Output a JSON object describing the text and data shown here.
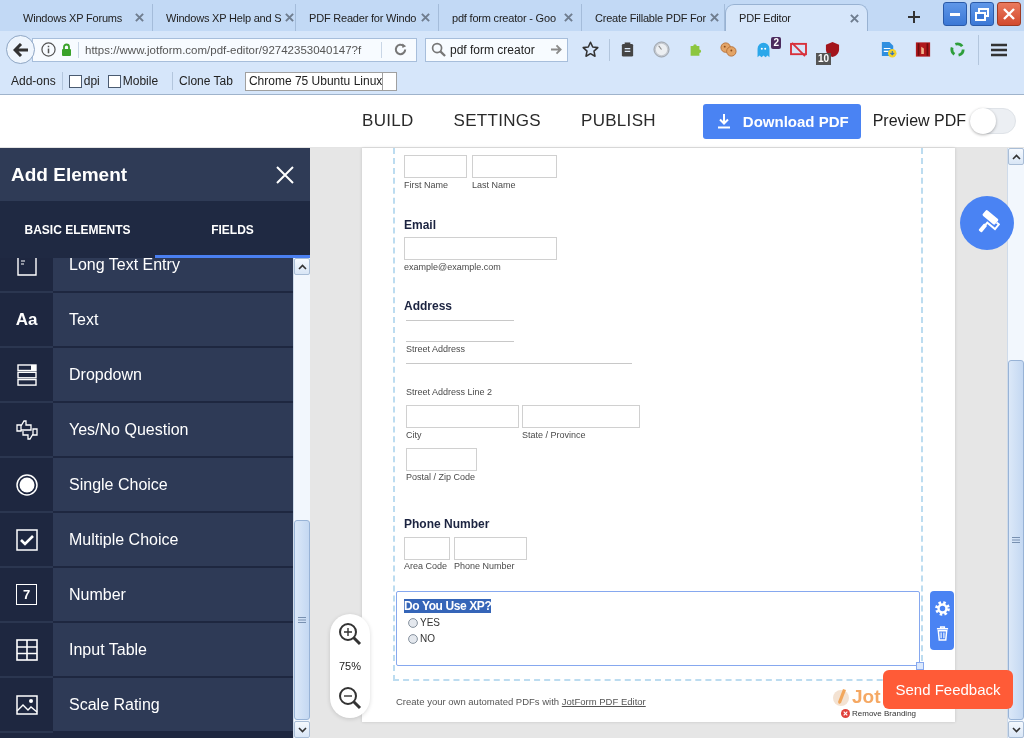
{
  "browser": {
    "tabs": [
      {
        "title": "Windows XP Forums",
        "selected": false
      },
      {
        "title": "Windows XP Help and S",
        "selected": false
      },
      {
        "title": "PDF Reader for Windo",
        "selected": false
      },
      {
        "title": "pdf form creator - Goo",
        "selected": false
      },
      {
        "title": "Create Fillable PDF For",
        "selected": false
      },
      {
        "title": "PDF Editor",
        "selected": true
      }
    ],
    "url": "https://www.jotform.com/pdf-editor/92742353040147?f",
    "search": {
      "value": "pdf form creator"
    },
    "extension_badges": [
      "2",
      "10"
    ],
    "addon_bar": {
      "label": "Add-ons",
      "checkboxes": [
        {
          "label": "dpi",
          "checked": false
        },
        {
          "label": "Mobile",
          "checked": false
        }
      ],
      "clone_tab": "Clone Tab",
      "user_agent": {
        "value": "Chrome 75 Ubuntu Linux"
      }
    }
  },
  "top_nav": {
    "links": [
      "BUILD",
      "SETTINGS",
      "PUBLISH"
    ],
    "download_button": "Download PDF",
    "preview_toggle": {
      "label": "Preview PDF",
      "on": false
    }
  },
  "sidebar": {
    "title": "Add Element",
    "tabs": [
      {
        "label": "BASIC ELEMENTS",
        "selected": false
      },
      {
        "label": "FIELDS",
        "selected": true
      }
    ],
    "items": [
      {
        "label": "Long Text Entry",
        "kind": "long-text"
      },
      {
        "label": "Text",
        "kind": "text",
        "icon_text": "Aa"
      },
      {
        "label": "Dropdown",
        "kind": "dropdown"
      },
      {
        "label": "Yes/No Question",
        "kind": "yes-no"
      },
      {
        "label": "Single Choice",
        "kind": "single-choice"
      },
      {
        "label": "Multiple Choice",
        "kind": "multiple-choice"
      },
      {
        "label": "Number",
        "kind": "number",
        "icon_text": "7"
      },
      {
        "label": "Input Table",
        "kind": "input-table"
      },
      {
        "label": "Scale Rating",
        "kind": "scale-rating"
      }
    ]
  },
  "form": {
    "name": {
      "sublabels": [
        "First Name",
        "Last Name"
      ]
    },
    "email": {
      "label": "Email",
      "sublabel": "example@example.com"
    },
    "address": {
      "label": "Address",
      "sublabels": [
        "Street Address",
        "Street Address Line 2",
        "City",
        "State / Province",
        "Postal / Zip Code"
      ]
    },
    "phone": {
      "label": "Phone Number",
      "sublabels": [
        "Area Code",
        "Phone Number"
      ]
    },
    "question": {
      "label": "Do You Use XP?",
      "selected": true,
      "options": [
        {
          "label": "YES",
          "checked": false
        },
        {
          "label": "NO",
          "checked": false
        }
      ]
    }
  },
  "footer": {
    "text": "Create your own automated PDFs with",
    "link": "JotForm PDF Editor",
    "logo": "Jot",
    "remove_branding": "Remove Branding"
  },
  "zoom": {
    "value": "75%"
  },
  "feedback_button": "Send Feedback"
}
